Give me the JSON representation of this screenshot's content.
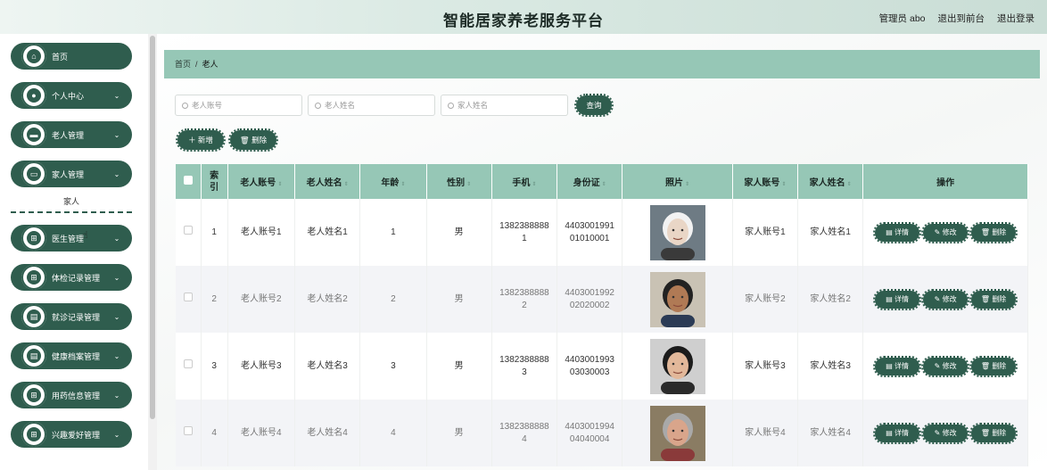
{
  "header": {
    "title": "智能居家养老服务平台",
    "user_label": "管理员 abo",
    "back_label": "退出到前台",
    "logout_label": "退出登录"
  },
  "sidebar": {
    "items": [
      {
        "label": "首页",
        "icon": "home-icon",
        "glyph": "⌂",
        "chevron": false
      },
      {
        "label": "个人中心",
        "icon": "person-icon",
        "glyph": "●",
        "chevron": true
      },
      {
        "label": "老人管理",
        "icon": "card-icon",
        "glyph": "▬",
        "chevron": true
      },
      {
        "label": "家人管理",
        "icon": "folder-icon",
        "glyph": "▭",
        "chevron": true
      },
      {
        "label": "医生管理",
        "icon": "grid-icon",
        "glyph": "⊞",
        "chevron": true
      },
      {
        "label": "体检记录管理",
        "icon": "grid-icon",
        "glyph": "⊞",
        "chevron": true
      },
      {
        "label": "就诊记录管理",
        "icon": "clipboard-icon",
        "glyph": "▤",
        "chevron": true
      },
      {
        "label": "健康档案管理",
        "icon": "clipboard-icon",
        "glyph": "▤",
        "chevron": true
      },
      {
        "label": "用药信息管理",
        "icon": "grid-icon",
        "glyph": "⊞",
        "chevron": true
      },
      {
        "label": "兴趣爱好管理",
        "icon": "grid-icon",
        "glyph": "⊞",
        "chevron": true
      }
    ],
    "submenu_label": "家人"
  },
  "breadcrumb": {
    "home": "首页",
    "sep": "/",
    "current": "老人"
  },
  "search": {
    "fields": [
      {
        "placeholder": "老人账号"
      },
      {
        "placeholder": "老人姓名"
      },
      {
        "placeholder": "家人姓名"
      }
    ],
    "query_label": "查询"
  },
  "actions": {
    "add_label": "＋ 新增",
    "delete_label": "🗑 删除"
  },
  "table": {
    "columns": [
      "索引",
      "老人账号",
      "老人姓名",
      "年龄",
      "性别",
      "手机",
      "身份证",
      "照片",
      "家人账号",
      "家人姓名",
      "操作"
    ],
    "rows": [
      {
        "index": "1",
        "account": "老人账号1",
        "name": "老人姓名1",
        "age": "1",
        "gender": "男",
        "phone": "1382388888\n1",
        "idcard": "4403001991\n01010001",
        "family_account": "家人账号1",
        "family_name": "家人姓名1"
      },
      {
        "index": "2",
        "account": "老人账号2",
        "name": "老人姓名2",
        "age": "2",
        "gender": "男",
        "phone": "1382388888\n2",
        "idcard": "4403001992\n02020002",
        "family_account": "家人账号2",
        "family_name": "家人姓名2"
      },
      {
        "index": "3",
        "account": "老人账号3",
        "name": "老人姓名3",
        "age": "3",
        "gender": "男",
        "phone": "1382388888\n3",
        "idcard": "4403001993\n03030003",
        "family_account": "家人账号3",
        "family_name": "家人姓名3"
      },
      {
        "index": "4",
        "account": "老人账号4",
        "name": "老人姓名4",
        "age": "4",
        "gender": "男",
        "phone": "1382388888\n4",
        "idcard": "4403001994\n04040004",
        "family_account": "家人账号4",
        "family_name": "家人姓名4"
      }
    ],
    "op_labels": {
      "detail": "详情",
      "edit": "修改",
      "delete": "删除"
    }
  },
  "colors": {
    "accent": "#2f5d4e",
    "header_fill": "#96c7b6"
  }
}
